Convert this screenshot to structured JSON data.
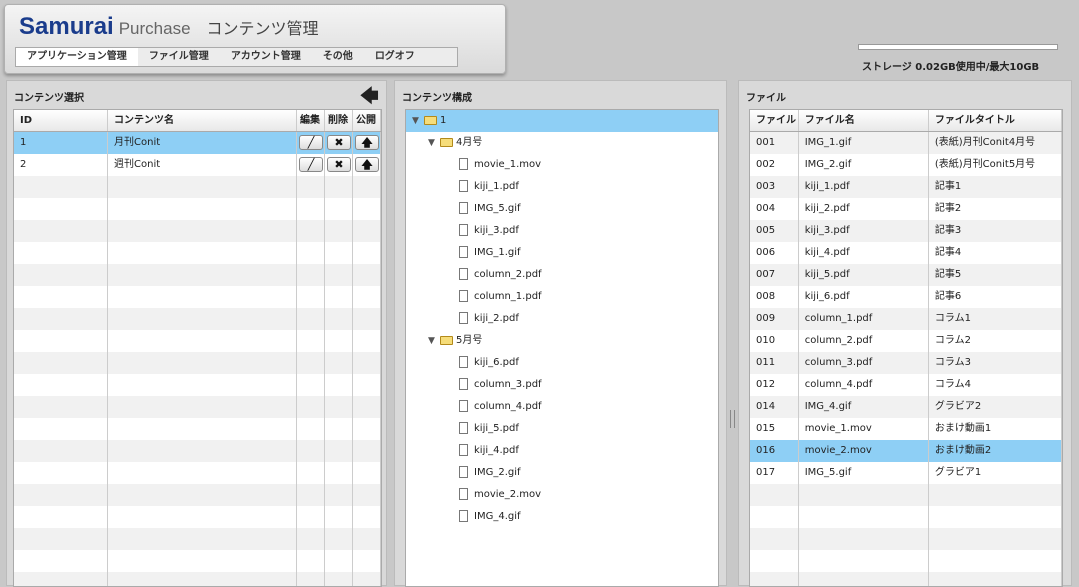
{
  "header": {
    "brand_samurai": "Samurai",
    "brand_purchase": "Purchase",
    "page_title": "コンテンツ管理",
    "nav": [
      "アプリケーション管理",
      "ファイル管理",
      "アカウント管理",
      "その他",
      "ログオフ"
    ],
    "active_tab": 0
  },
  "storage": {
    "text": "ストレージ 0.02GB使用中/最大10GB"
  },
  "content_select": {
    "title": "コンテンツ選択",
    "columns": [
      "ID",
      "コンテンツ名",
      "編集",
      "削除",
      "公開"
    ],
    "rows": [
      {
        "id": "1",
        "name": "月刊Conit",
        "selected": true
      },
      {
        "id": "2",
        "name": "週刊Conit",
        "selected": false
      }
    ],
    "icons": {
      "edit": "pencil-icon",
      "delete": "x-icon",
      "publish": "up-arrow-icon",
      "back": "left-arrow-icon"
    }
  },
  "structure": {
    "title": "コンテンツ構成",
    "root": "1",
    "folders": [
      {
        "name": "4月号",
        "files": [
          "movie_1.mov",
          "kiji_1.pdf",
          "IMG_5.gif",
          "kiji_3.pdf",
          "IMG_1.gif",
          "column_2.pdf",
          "column_1.pdf",
          "kiji_2.pdf"
        ]
      },
      {
        "name": "5月号",
        "files": [
          "kiji_6.pdf",
          "column_3.pdf",
          "column_4.pdf",
          "kiji_5.pdf",
          "kiji_4.pdf",
          "IMG_2.gif",
          "movie_2.mov",
          "IMG_4.gif"
        ]
      }
    ]
  },
  "files": {
    "title": "ファイル",
    "columns": [
      "ファイル",
      "ファイル名",
      "ファイルタイトル"
    ],
    "rows": [
      [
        "001",
        "IMG_1.gif",
        "(表紙)月刊Conit4月号"
      ],
      [
        "002",
        "IMG_2.gif",
        "(表紙)月刊Conit5月号"
      ],
      [
        "003",
        "kiji_1.pdf",
        "記事1"
      ],
      [
        "004",
        "kiji_2.pdf",
        "記事2"
      ],
      [
        "005",
        "kiji_3.pdf",
        "記事3"
      ],
      [
        "006",
        "kiji_4.pdf",
        "記事4"
      ],
      [
        "007",
        "kiji_5.pdf",
        "記事5"
      ],
      [
        "008",
        "kiji_6.pdf",
        "記事6"
      ],
      [
        "009",
        "column_1.pdf",
        "コラム1"
      ],
      [
        "010",
        "column_2.pdf",
        "コラム2"
      ],
      [
        "011",
        "column_3.pdf",
        "コラム3"
      ],
      [
        "012",
        "column_4.pdf",
        "コラム4"
      ],
      [
        "014",
        "IMG_4.gif",
        "グラビア2"
      ],
      [
        "015",
        "movie_1.mov",
        "おまけ動画1"
      ],
      [
        "016",
        "movie_2.mov",
        "おまけ動画2"
      ],
      [
        "017",
        "IMG_5.gif",
        "グラビア1"
      ]
    ],
    "selected_row": 14
  },
  "colors": {
    "selection": "#8ecff5",
    "brand": "#1a3c8c"
  }
}
